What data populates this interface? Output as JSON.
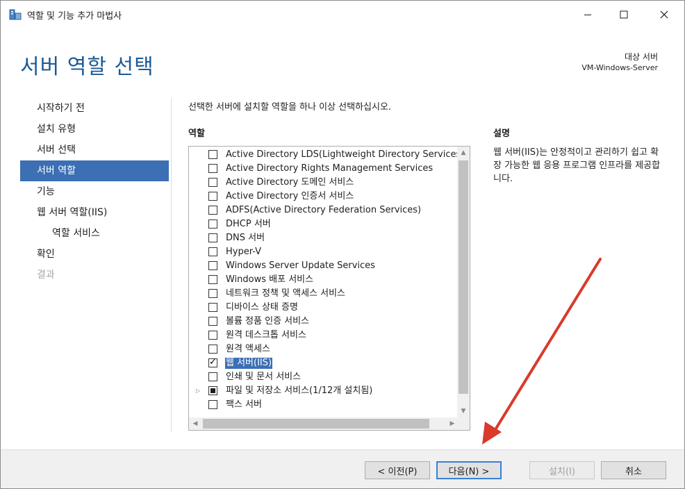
{
  "window": {
    "title": "역할 및 기능 추가 마법사",
    "icons": {
      "app": "server-manager-icon",
      "minimize": "minimize-icon",
      "maximize": "maximize-icon",
      "close": "close-icon"
    }
  },
  "header": {
    "page_title": "서버 역할 선택",
    "target_label": "대상 서버",
    "target_server": "VM-Windows-Server"
  },
  "nav": {
    "items": [
      {
        "label": "시작하기 전",
        "state": "normal"
      },
      {
        "label": "설치 유형",
        "state": "normal"
      },
      {
        "label": "서버 선택",
        "state": "normal"
      },
      {
        "label": "서버 역할",
        "state": "active"
      },
      {
        "label": "기능",
        "state": "normal"
      },
      {
        "label": "웹 서버 역할(IIS)",
        "state": "normal"
      },
      {
        "label": "역할 서비스",
        "state": "sub"
      },
      {
        "label": "확인",
        "state": "normal"
      },
      {
        "label": "결과",
        "state": "disabled"
      }
    ]
  },
  "content": {
    "instruction": "선택한 서버에 설치할 역할을 하나 이상 선택하십시오.",
    "roles_header": "역할",
    "description_header": "설명",
    "description_text": "웹 서버(IIS)는 안정적이고 관리하기 쉽고 확장 가능한 웹 응용 프로그램 인프라를 제공합니다."
  },
  "roles": [
    {
      "label": "Active Directory LDS(Lightweight Directory Services)",
      "state": "unchecked"
    },
    {
      "label": "Active Directory Rights Management Services",
      "state": "unchecked"
    },
    {
      "label": "Active Directory 도메인 서비스",
      "state": "unchecked"
    },
    {
      "label": "Active Directory 인증서 서비스",
      "state": "unchecked"
    },
    {
      "label": "ADFS(Active Directory Federation Services)",
      "state": "unchecked"
    },
    {
      "label": "DHCP 서버",
      "state": "unchecked"
    },
    {
      "label": "DNS 서버",
      "state": "unchecked"
    },
    {
      "label": "Hyper-V",
      "state": "unchecked"
    },
    {
      "label": "Windows Server Update Services",
      "state": "unchecked"
    },
    {
      "label": "Windows 배포 서비스",
      "state": "unchecked"
    },
    {
      "label": "네트워크 정책 및 액세스 서비스",
      "state": "unchecked"
    },
    {
      "label": "디바이스 상태 증명",
      "state": "unchecked"
    },
    {
      "label": "볼륨 정품 인증 서비스",
      "state": "unchecked"
    },
    {
      "label": "원격 데스크톱 서비스",
      "state": "unchecked"
    },
    {
      "label": "원격 액세스",
      "state": "unchecked"
    },
    {
      "label": "웹 서버(IIS)",
      "state": "checked",
      "selected": true
    },
    {
      "label": "인쇄 및 문서 서비스",
      "state": "unchecked"
    },
    {
      "label": "파일 및 저장소 서비스(1/12개 설치됨)",
      "state": "partial",
      "expandable": true
    },
    {
      "label": "팩스 서버",
      "state": "unchecked"
    }
  ],
  "buttons": {
    "previous": "< 이전(P)",
    "next": "다음(N) >",
    "install": "설치(I)",
    "cancel": "취소"
  },
  "colors": {
    "title_blue": "#1a5a96",
    "selection_blue": "#3c6fb4",
    "annotation_arrow": "#d93a2b"
  }
}
